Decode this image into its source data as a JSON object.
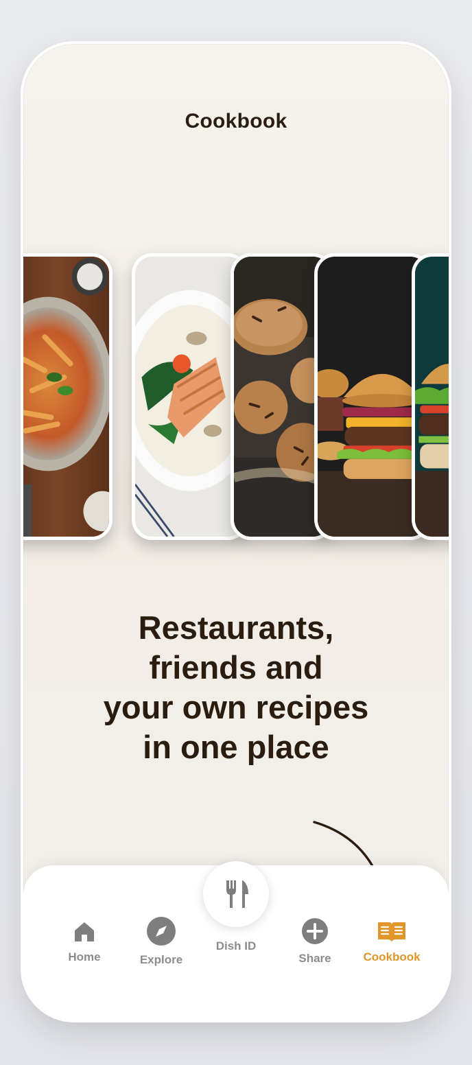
{
  "header": {
    "title": "Cookbook"
  },
  "carousel": {
    "items": [
      {
        "name": "pasta-dish"
      },
      {
        "name": "salmon-dish"
      },
      {
        "name": "bread-rolls"
      },
      {
        "name": "burger"
      },
      {
        "name": "burger-partial"
      }
    ]
  },
  "headline": {
    "line1": "Restaurants,",
    "line2": "friends and",
    "line3": "your own recipes",
    "line4": "in one place"
  },
  "tabbar": {
    "home": {
      "label": "Home",
      "icon": "home-icon"
    },
    "explore": {
      "label": "Explore",
      "icon": "compass-icon"
    },
    "dish_id": {
      "label": "Dish ID",
      "icon": "fork-knife-icon"
    },
    "share": {
      "label": "Share",
      "icon": "plus-circle-icon"
    },
    "cookbook": {
      "label": "Cookbook",
      "icon": "book-icon"
    }
  },
  "colors": {
    "accent": "#e0962a",
    "inactive": "#8c8c8c",
    "text": "#2b1c10"
  }
}
